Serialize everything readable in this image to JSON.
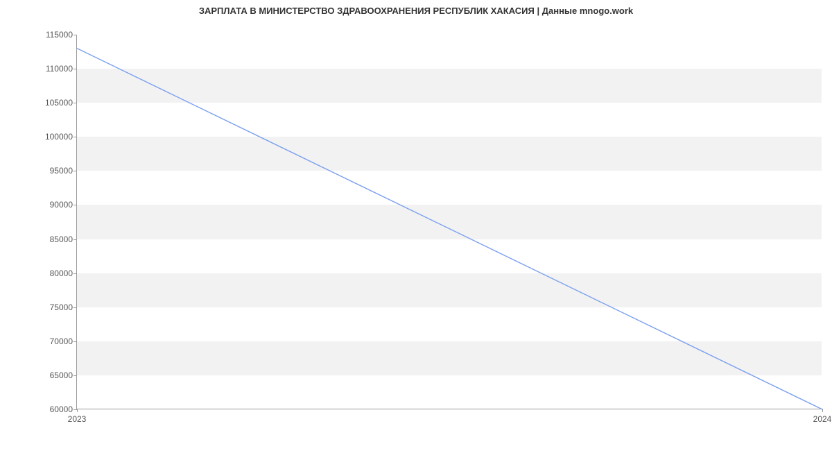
{
  "chart_data": {
    "type": "line",
    "title": "ЗАРПЛАТА В МИНИСТЕРСТВО ЗДРАВООХРАНЕНИЯ РЕСПУБЛИК ХАКАСИЯ | Данные mnogo.work",
    "xlabel": "",
    "ylabel": "",
    "x": [
      2023,
      2024
    ],
    "values": [
      113000,
      60000
    ],
    "x_ticks": [
      2023,
      2024
    ],
    "y_ticks": [
      60000,
      65000,
      70000,
      75000,
      80000,
      85000,
      90000,
      95000,
      100000,
      105000,
      110000,
      115000
    ],
    "xlim": [
      2023,
      2024
    ],
    "ylim": [
      60000,
      115000
    ],
    "grid_bands": true,
    "line_color": "#7a9ff0"
  }
}
